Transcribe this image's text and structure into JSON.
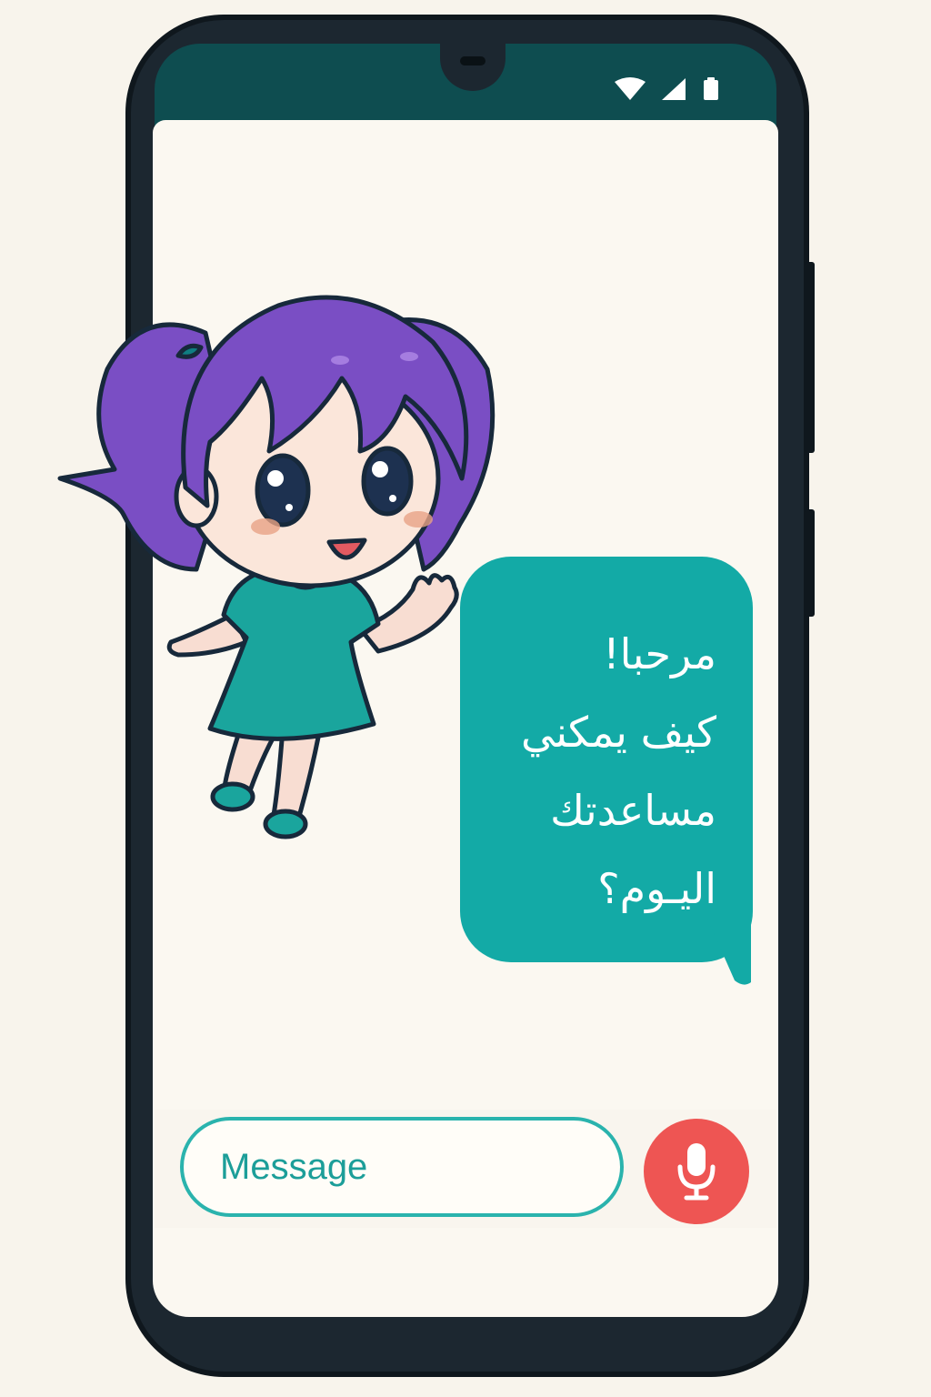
{
  "status_bar": {
    "icons": [
      "wifi-icon",
      "signal-icon",
      "battery-icon"
    ]
  },
  "chat": {
    "message_lines": [
      "مرحبا!",
      "كيف يمكني",
      "مساعدتك",
      "اليـوم؟"
    ],
    "bubble_color": "#13aaa6",
    "text_color": "#ffffff"
  },
  "composer": {
    "placeholder": "Message",
    "mic_color": "#ee5553",
    "accent_color": "#2ab3ad"
  },
  "colors": {
    "phone_frame": "#1c2730",
    "screen_top": "#0e4d50",
    "screen_bg": "#fbf8f1",
    "page_bg": "#f8f4ec"
  }
}
